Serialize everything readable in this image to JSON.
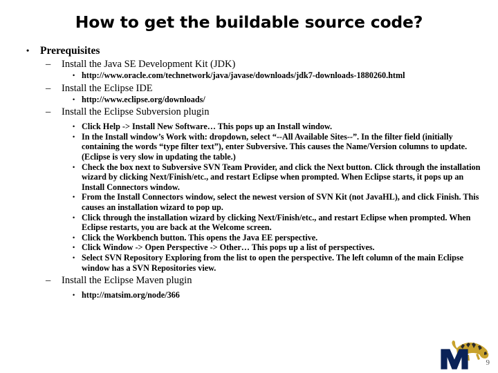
{
  "slide": {
    "title": "How to get the buildable source code?",
    "page_number": "9",
    "logo": {
      "name": "university-of-memphis-tiger-logo",
      "letter": "M",
      "primary_color": "#0a2257",
      "accent_color": "#c8a22c",
      "tiger_dark": "#2b2b2b"
    }
  },
  "outline": [
    {
      "level": 1,
      "marker": "•",
      "text": "Prerequisites"
    },
    {
      "level": 2,
      "marker": "–",
      "text": "Install the Java SE Development Kit (JDK)"
    },
    {
      "level": 3,
      "marker": "•",
      "text": "http://www.oracle.com/technetwork/java/javase/downloads/jdk7-downloads-1880260.html"
    },
    {
      "level": 2,
      "marker": "–",
      "text": "Install the Eclipse IDE"
    },
    {
      "level": 3,
      "marker": "•",
      "text": "http://www.eclipse.org/downloads/"
    },
    {
      "level": 2,
      "marker": "–",
      "text": "Install the Eclipse Subversion plugin"
    },
    {
      "level": 3,
      "marker": "•",
      "text": "Click Help -> Install New Software… This pops up an Install window."
    },
    {
      "level": 3,
      "marker": "•",
      "text": "In the Install window’s Work with: dropdown, select “--All Available Sites--”. In the filter field (initially containing the words “type filter text”), enter Subversive. This causes the Name/Version columns to update. (Eclipse is very slow in updating the table.)"
    },
    {
      "level": 3,
      "marker": "•",
      "text": "Check the box next to Subversive SVN Team Provider, and click the Next button. Click through the installation wizard by clicking Next/Finish/etc., and restart Eclipse when prompted. When Eclipse starts, it pops up an Install Connectors window."
    },
    {
      "level": 3,
      "marker": "•",
      "text": "From the Install Connectors window, select the newest version of SVN Kit (not JavaHL), and click Finish. This causes an installation wizard to pop up."
    },
    {
      "level": 3,
      "marker": "•",
      "text": "Click through the installation wizard by clicking Next/Finish/etc., and restart Eclipse when prompted. When Eclipse restarts, you are back at the Welcome screen."
    },
    {
      "level": 3,
      "marker": "•",
      "text": "Click the Workbench button. This opens the Java EE perspective."
    },
    {
      "level": 3,
      "marker": "•",
      "text": "Click Window -> Open Perspective -> Other… This pops up a list of perspectives."
    },
    {
      "level": 3,
      "marker": "•",
      "text": "Select SVN Repository Exploring from the list to open the perspective. The left column of the main Eclipse window has a SVN Repositories view."
    },
    {
      "level": 2,
      "marker": "–",
      "text": "Install the Eclipse Maven plugin"
    },
    {
      "level": 3,
      "marker": "•",
      "text": "http://matsim.org/node/366"
    }
  ]
}
